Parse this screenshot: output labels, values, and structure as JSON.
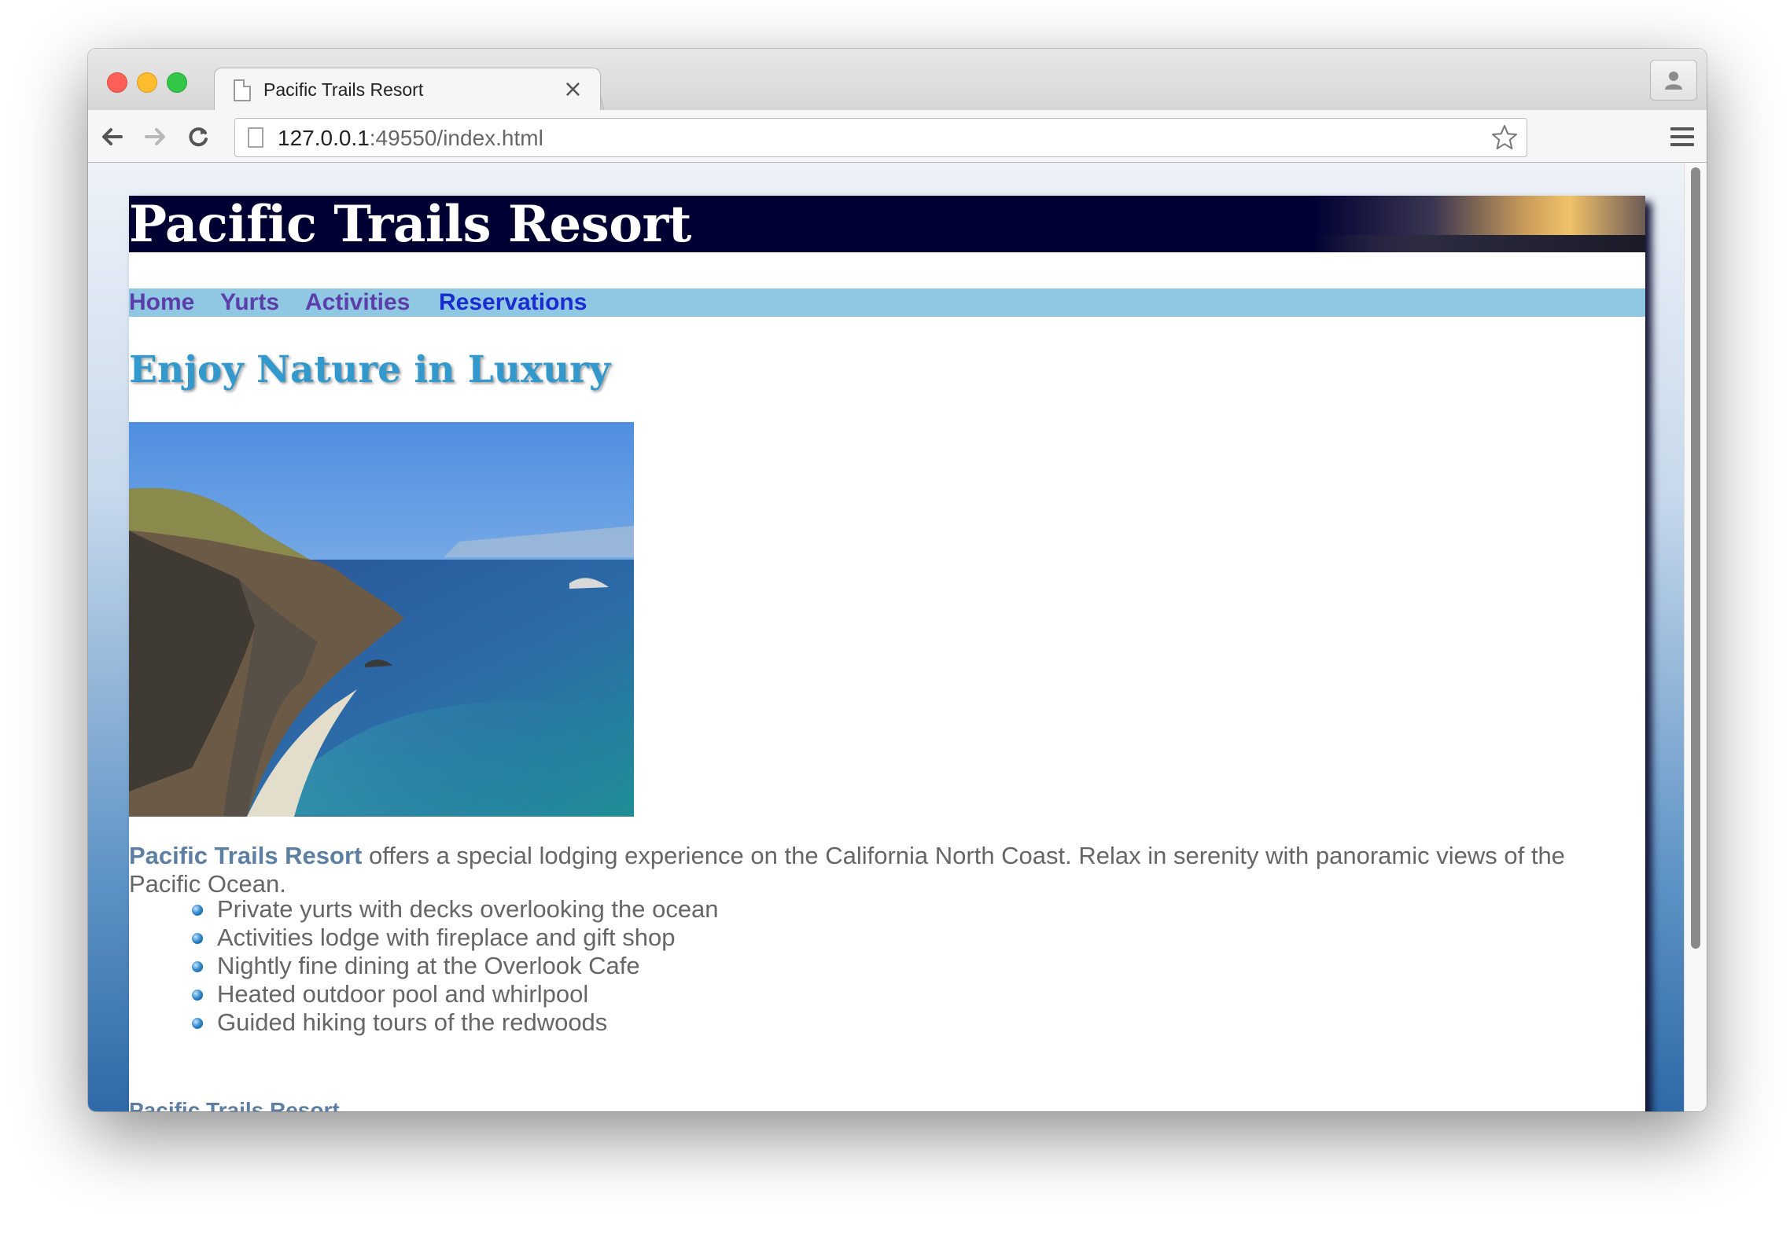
{
  "browser": {
    "tab_title": "Pacific Trails Resort",
    "tab_close": "×",
    "url_host": "127.0.0.1",
    "url_rest": ":49550/index.html"
  },
  "site": {
    "title": "Pacific Trails Resort",
    "nav": [
      "Home",
      "Yurts",
      "Activities",
      "Reservations"
    ],
    "headline": "Enjoy Nature in Luxury",
    "intro_name": "Pacific Trails Resort",
    "intro_text": " offers a special lodging experience on the California North Coast. Relax in serenity with panoramic views of the Pacific Ocean.",
    "features": [
      "Private yurts with decks overlooking the ocean",
      "Activities lodge with fireplace and gift shop",
      "Nightly fine dining at the Overlook Cafe",
      "Heated outdoor pool and whirlpool",
      "Guided hiking tours of the redwoods"
    ],
    "contact_name": "Pacific Trails Resort"
  },
  "colors": {
    "banner": "#000033",
    "nav_bar": "#90c7e3",
    "nav_link": "#5c3eab",
    "headline": "#3399cc",
    "text": "#666666"
  }
}
